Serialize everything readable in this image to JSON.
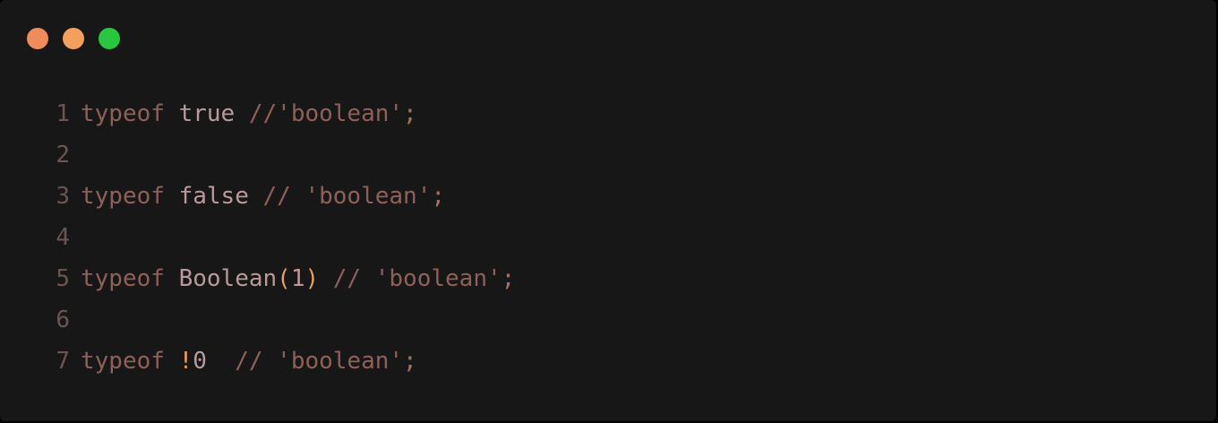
{
  "window": {
    "traffic_lights": [
      {
        "name": "close-button",
        "color": "#ef8c5a"
      },
      {
        "name": "minimize-button",
        "color": "#f3a05f"
      },
      {
        "name": "maximize-button",
        "color": "#29c73f"
      }
    ]
  },
  "colors": {
    "keyword": "#8f6058",
    "value": "#b99a9a",
    "comment": "#8f6058",
    "string": "#a0725e",
    "punct": "#a0725e",
    "paren": "#e59f61",
    "number": "#b99a9a",
    "operator": "#f0a05e",
    "line_number": "#6b5550"
  },
  "code": {
    "lines": [
      {
        "n": "1",
        "tokens": [
          {
            "t": "typeof",
            "c": "keyword"
          },
          {
            "t": " ",
            "c": "value"
          },
          {
            "t": "true",
            "c": "value"
          },
          {
            "t": " ",
            "c": "value"
          },
          {
            "t": "//'boolean'",
            "c": "comment"
          },
          {
            "t": ";",
            "c": "punct"
          }
        ]
      },
      {
        "n": "2",
        "tokens": []
      },
      {
        "n": "3",
        "tokens": [
          {
            "t": "typeof",
            "c": "keyword"
          },
          {
            "t": " ",
            "c": "value"
          },
          {
            "t": "false",
            "c": "value"
          },
          {
            "t": " ",
            "c": "value"
          },
          {
            "t": "// 'boolean'",
            "c": "comment"
          },
          {
            "t": ";",
            "c": "punct"
          }
        ]
      },
      {
        "n": "4",
        "tokens": []
      },
      {
        "n": "5",
        "tokens": [
          {
            "t": "typeof",
            "c": "keyword"
          },
          {
            "t": " ",
            "c": "value"
          },
          {
            "t": "Boolean",
            "c": "value"
          },
          {
            "t": "(",
            "c": "paren"
          },
          {
            "t": "1",
            "c": "number"
          },
          {
            "t": ")",
            "c": "paren"
          },
          {
            "t": " ",
            "c": "value"
          },
          {
            "t": "// 'boolean'",
            "c": "comment"
          },
          {
            "t": ";",
            "c": "punct"
          }
        ]
      },
      {
        "n": "6",
        "tokens": []
      },
      {
        "n": "7",
        "tokens": [
          {
            "t": "typeof",
            "c": "keyword"
          },
          {
            "t": " ",
            "c": "value"
          },
          {
            "t": "!",
            "c": "operator"
          },
          {
            "t": "0",
            "c": "number"
          },
          {
            "t": "  ",
            "c": "value"
          },
          {
            "t": "// 'boolean'",
            "c": "comment"
          },
          {
            "t": ";",
            "c": "punct"
          }
        ]
      }
    ]
  }
}
